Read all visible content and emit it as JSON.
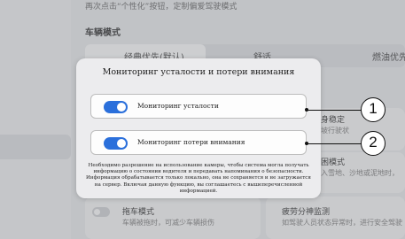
{
  "background": {
    "top_note": "再次点击“个性化”按钮，定制偏爱驾驶模式",
    "section_title": "车辆模式",
    "mode_tabs": [
      "经典优先(默认)",
      "舒适",
      "燃油优先"
    ],
    "right_cards": [
      {
        "title": "身稳定",
        "subtitle": "坡行驶状"
      },
      {
        "title": "困模式",
        "subtitle": "入雪地、沙地或泥地时，"
      }
    ],
    "bottom_cards": [
      {
        "title": "拖车模式",
        "subtitle": "车辆被拖时，可减少车辆损伤"
      },
      {
        "title": "疲劳分神监测",
        "subtitle": "如驾驶人员状态异常时，进行安全驾驶"
      }
    ]
  },
  "dialog": {
    "title": "Мониторинг усталости и потери внимания",
    "options": [
      {
        "label": "Мониторинг усталости",
        "enabled": true
      },
      {
        "label": "Мониторинг потери внимания",
        "enabled": true
      }
    ],
    "note": "Необходимо разрешение на использование камеры, чтобы система могла получать информацию о состоянии водителя и передавать напоминания о безопасности. Информация обрабатывается только локально, она не сохраняется и не загружается на сервер. Включая данную функцию, вы соглашаетесь с вышеперечисленной информацией."
  },
  "callouts": [
    "1",
    "2"
  ],
  "colors": {
    "toggle_on": "#2a6fdb",
    "dialog_bg": "#ececee"
  }
}
